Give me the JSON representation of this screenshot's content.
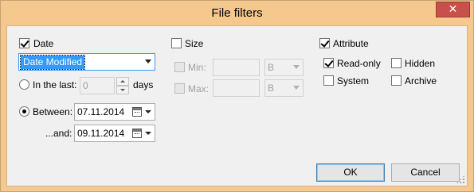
{
  "window": {
    "title": "File filters",
    "close_glyph": "✕"
  },
  "date": {
    "checkbox_label": "Date",
    "checked": true,
    "type_value": "Date Modified",
    "in_last_label": "In the last:",
    "in_last_value": "0",
    "in_last_unit": "days",
    "between_label": "Between:",
    "between_value": "07.11.2014",
    "and_label": "...and:",
    "and_value": "09.11.2014"
  },
  "size": {
    "checkbox_label": "Size",
    "checked": false,
    "min_label": "Min:",
    "min_value": "",
    "min_unit": "B",
    "max_label": "Max:",
    "max_value": "",
    "max_unit": "B"
  },
  "attribute": {
    "checkbox_label": "Attribute",
    "checked": true,
    "readonly_label": "Read-only",
    "hidden_label": "Hidden",
    "system_label": "System",
    "archive_label": "Archive"
  },
  "buttons": {
    "ok_label": "OK",
    "cancel_label": "Cancel"
  },
  "colors": {
    "title_bar": "#f5c88e",
    "close_button": "#c7504a",
    "client_bg": "#f0f0f0",
    "selection": "#3399ff"
  }
}
